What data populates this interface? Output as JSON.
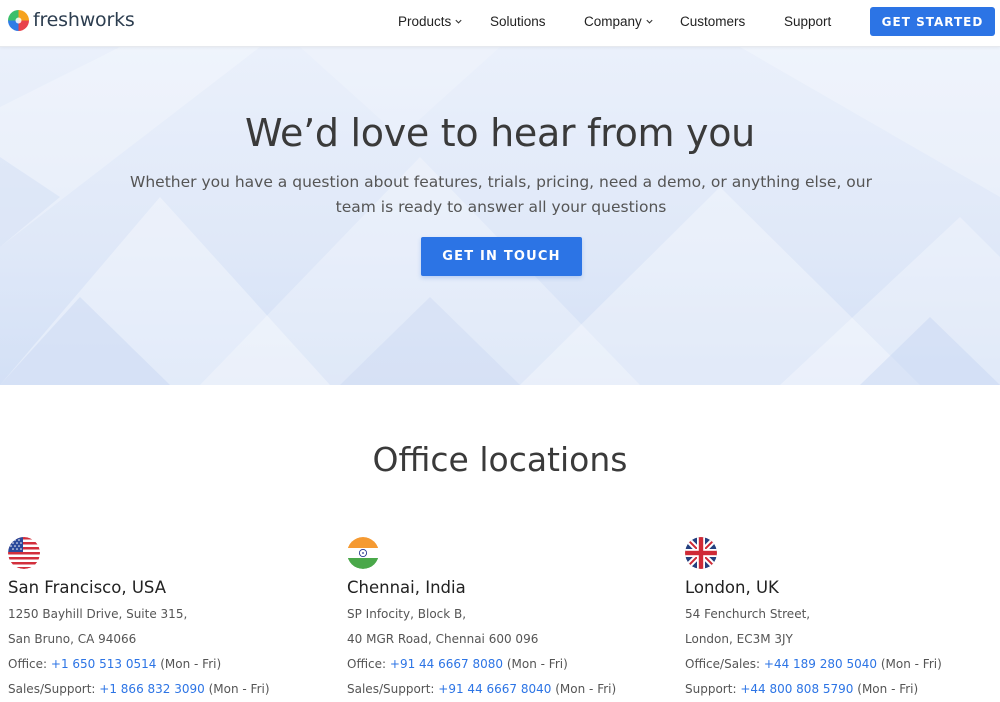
{
  "header": {
    "logo_text": "freshworks",
    "nav": [
      {
        "label": "Products",
        "has_dropdown": true
      },
      {
        "label": "Solutions",
        "has_dropdown": false
      },
      {
        "label": "Company",
        "has_dropdown": true
      },
      {
        "label": "Customers",
        "has_dropdown": false
      },
      {
        "label": "Support",
        "has_dropdown": false
      }
    ],
    "cta_label": "GET STARTED"
  },
  "hero": {
    "title": "We’d love to hear from you",
    "subtitle": "Whether you have a question about features, trials, pricing, need a demo, or anything else, our team is ready to answer all your questions",
    "cta_label": "GET IN TOUCH"
  },
  "offices": {
    "title": "Office locations",
    "items": [
      {
        "flag": "us-flag-icon",
        "name": "San Francisco, USA",
        "address1": "1250 Bayhill Drive, Suite 315,",
        "address2": "San Bruno, CA 94066",
        "phone1_label": "Office:",
        "phone1": "+1 650 513 0514",
        "phone1_hours": "(Mon - Fri)",
        "phone2_label": "Sales/Support:",
        "phone2": "+1 866 832 3090",
        "phone2_hours": "(Mon - Fri)"
      },
      {
        "flag": "india-flag-icon",
        "name": "Chennai, India",
        "address1": "SP Infocity, Block B,",
        "address2": "40 MGR Road, Chennai 600 096",
        "phone1_label": "Office:",
        "phone1": "+91 44 6667 8080",
        "phone1_hours": "(Mon - Fri)",
        "phone2_label": "Sales/Support:",
        "phone2": "+91 44 6667 8040",
        "phone2_hours": "(Mon - Fri)"
      },
      {
        "flag": "uk-flag-icon",
        "name": "London, UK",
        "address1": "54 Fenchurch Street,",
        "address2": "London, EC3M 3JY",
        "phone1_label": "Office/Sales:",
        "phone1": "+44 189 280 5040",
        "phone1_hours": "(Mon - Fri)",
        "phone2_label": "Support:",
        "phone2": "+44 800 808 5790",
        "phone2_hours": "(Mon - Fri)"
      }
    ]
  },
  "colors": {
    "accent": "#2c74e5",
    "heading": "#3a3a3a",
    "hero_bg": "#dfe8f8"
  }
}
